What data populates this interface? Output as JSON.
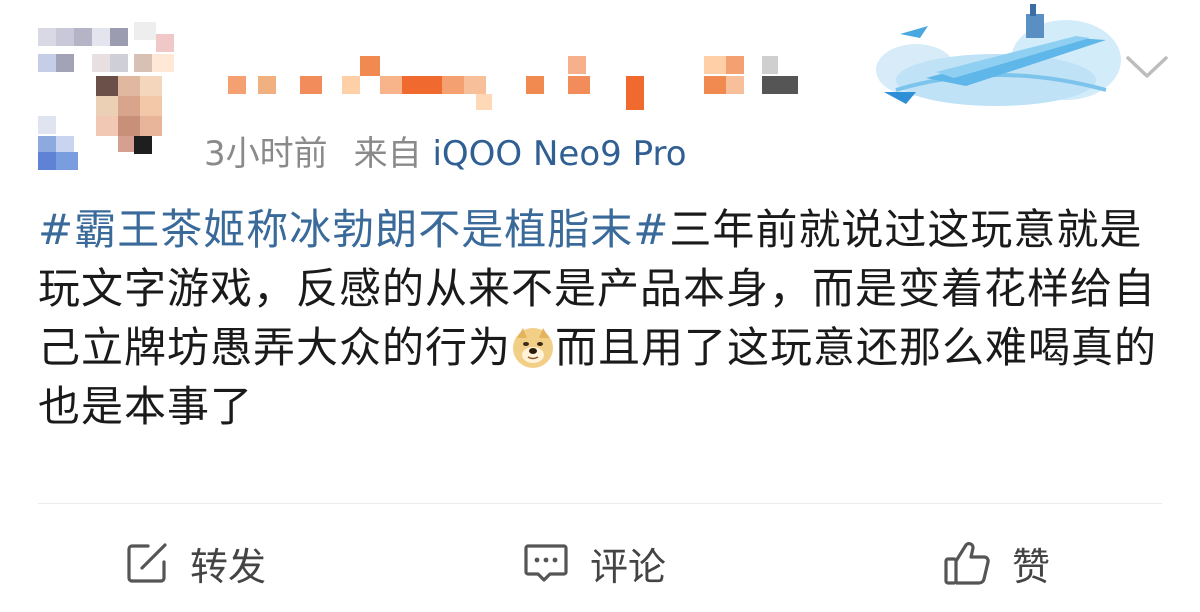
{
  "header": {
    "timestamp": "3小时前",
    "source_prefix": "来自",
    "device": "iQOO Neo9 Pro"
  },
  "post": {
    "hashtag": "#霸王茶姬称冰勃朗不是植脂末#",
    "body": "三年前就说过这玩意就是玩文字游戏，反感的从来不是产品本身，而是变着花样给自己立牌坊愚弄大众的行为",
    "emoji": "doge-emoji",
    "body_after_emoji": "而且用了这玩意还那么难喝真的也是本事了"
  },
  "actions": {
    "repost_label": "转发",
    "comment_label": "评论",
    "like_label": "赞"
  },
  "colors": {
    "link": "#3a6a9a",
    "meta": "#8a8a8a",
    "text": "#1a1a1a",
    "icon": "#555555"
  }
}
